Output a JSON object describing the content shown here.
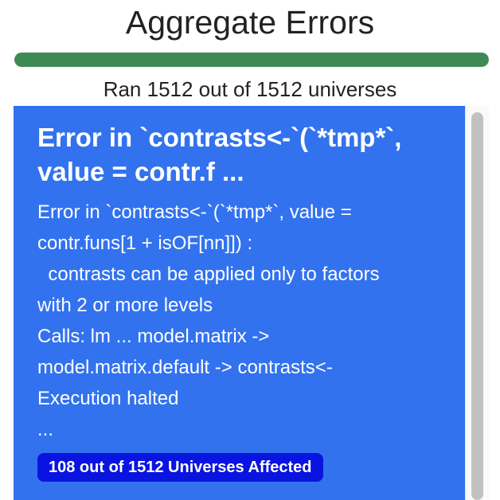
{
  "header": {
    "title": "Aggregate Errors"
  },
  "progress": {
    "completed": 1512,
    "total": 1512,
    "fraction": 1.0,
    "color": "#3d8a55",
    "status_text": "Ran 1512 out of 1512 universes"
  },
  "errors": [
    {
      "title": "Error in `contrasts<-`(`*tmp*`, value = contr.f ...",
      "body": "Error in `contrasts<-`(`*tmp*`, value =\ncontr.funs[1 + isOF[nn]]) :\n  contrasts can be applied only to factors\nwith 2 or more levels\nCalls: lm ... model.matrix ->\nmodel.matrix.default -> contrasts<-\nExecution halted\n...",
      "affected_label": "108 out of 1512 Universes Affected",
      "card_color": "#3272ef",
      "badge_color": "#0a14e0"
    }
  ]
}
